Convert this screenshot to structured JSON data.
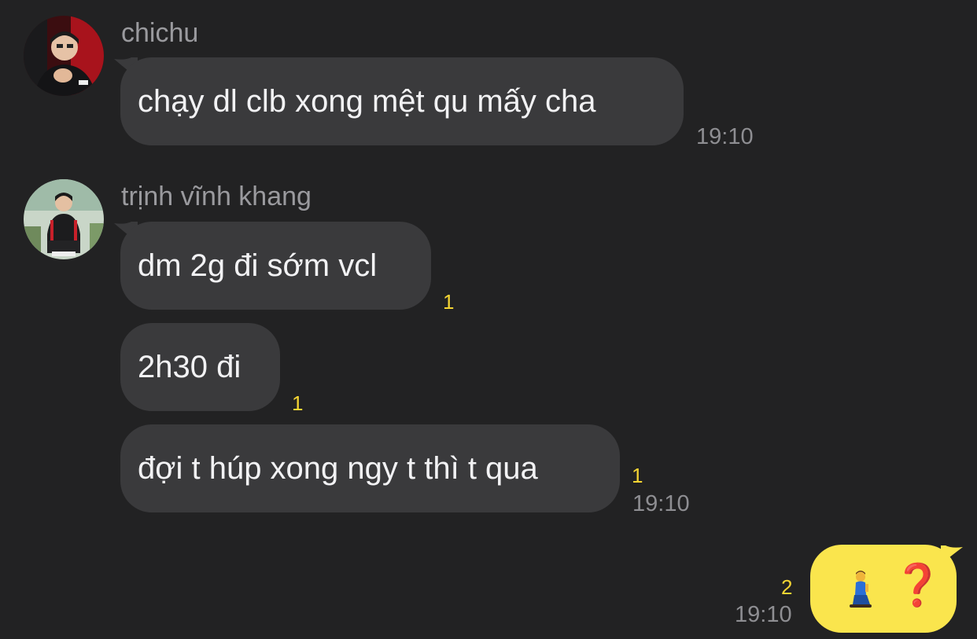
{
  "messages": [
    {
      "sender": "chichu",
      "avatar_icon": "avatar-player-red-jersey",
      "texts": [
        "chạy dl clb xong mệt qu mấy cha"
      ],
      "unread": [
        ""
      ],
      "time": "19:10"
    },
    {
      "sender": "trịnh vĩnh khang",
      "avatar_icon": "avatar-seated-person",
      "texts": [
        "dm 2g đi sớm vcl",
        "2h30 đi",
        "đợi t húp xong ngy t thì t qua"
      ],
      "unread": [
        "1",
        "1",
        "1"
      ],
      "time": "19:10"
    }
  ],
  "my_message": {
    "emoji_icon": "kneeling-person-icon",
    "question_mark": "❓",
    "unread": "2",
    "time": "19:10"
  },
  "colors": {
    "background": "#222223",
    "incoming_bubble": "#3a3a3c",
    "outgoing_bubble": "#fae54d",
    "unread_count": "#f5d533",
    "timestamp": "#8e8e92"
  }
}
